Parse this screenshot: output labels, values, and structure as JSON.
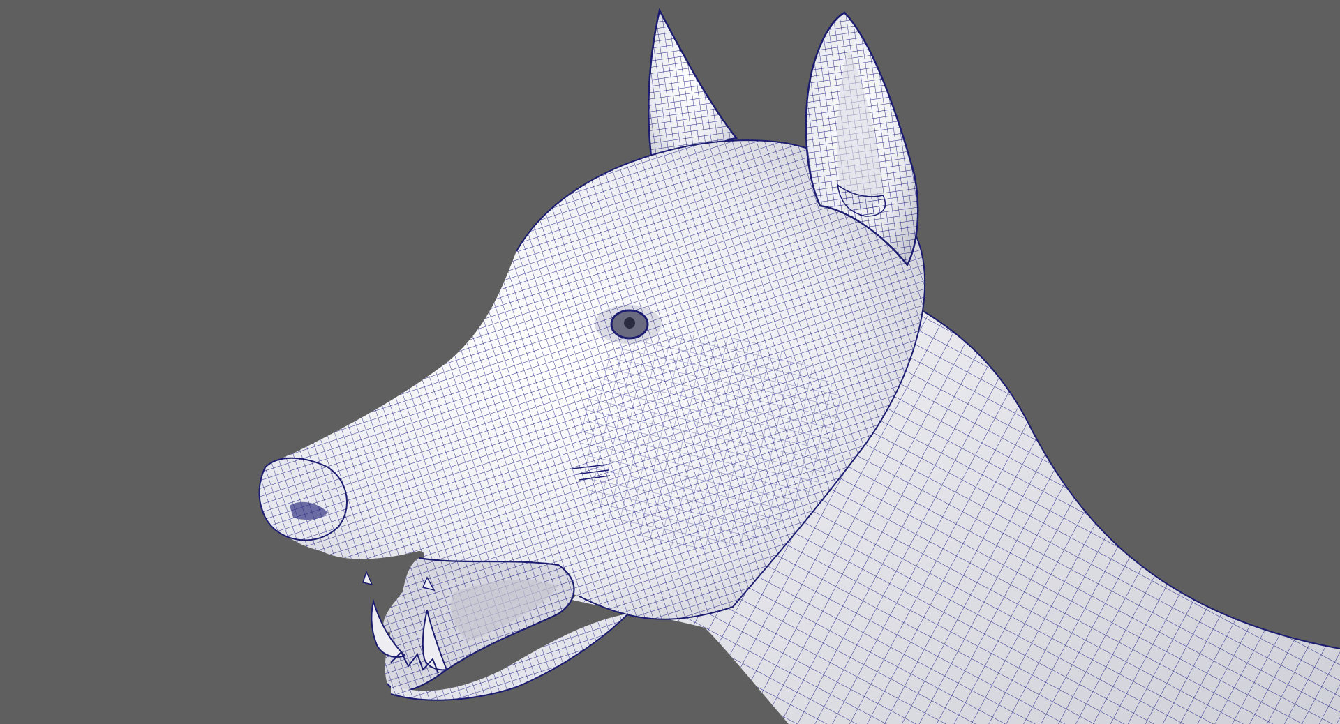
{
  "viewport": {
    "background_color": "#5f5f5f",
    "subject": "wireframe-dog-head",
    "mesh_fill_color": "#f2f2f4",
    "mesh_shade_color": "#c9c9d0",
    "wire_color": "#2a2a8a",
    "detail_wire_color": "#1c1c70"
  }
}
